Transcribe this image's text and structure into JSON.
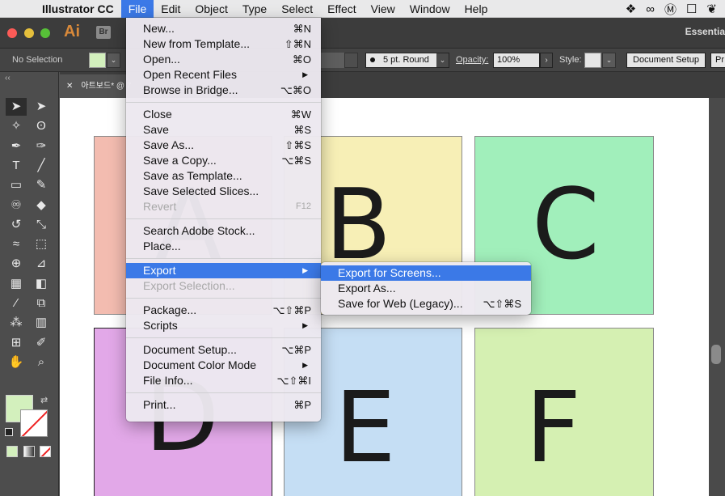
{
  "menubar": {
    "apple": "",
    "app_name": "Illustrator CC",
    "items": [
      "File",
      "Edit",
      "Object",
      "Type",
      "Select",
      "Effect",
      "View",
      "Window",
      "Help"
    ],
    "status_icons": [
      "dropbox-icon",
      "creative-cloud-icon",
      "malwarebytes-icon",
      "square-icon",
      "evernote-icon"
    ]
  },
  "appbar": {
    "ai_logo": "Ai",
    "br_logo": "Br",
    "workspace": "Essentia"
  },
  "controlbar": {
    "selection": "No Selection",
    "brush": "5 pt. Round",
    "opacity_label": "Opacity:",
    "opacity_value": "100%",
    "style_label": "Style:",
    "document_setup": "Document Setup",
    "preferences": "Pr",
    "fill_color": "#d3f0bd"
  },
  "document_tab": {
    "title": "아트보드* @ 7"
  },
  "artboards": [
    {
      "letter": "A",
      "color": "#f3bcb0"
    },
    {
      "letter": "B",
      "color": "#f7efb6"
    },
    {
      "letter": "C",
      "color": "#a1efbb"
    },
    {
      "letter": "D",
      "color": "#e2a8e8"
    },
    {
      "letter": "E",
      "color": "#c5def4"
    },
    {
      "letter": "F",
      "color": "#d5f0b2"
    }
  ],
  "file_menu": {
    "groups": [
      [
        {
          "label": "New...",
          "shortcut": "⌘N"
        },
        {
          "label": "New from Template...",
          "shortcut": "⇧⌘N"
        },
        {
          "label": "Open...",
          "shortcut": "⌘O"
        },
        {
          "label": "Open Recent Files",
          "submenu": true
        },
        {
          "label": "Browse in Bridge...",
          "shortcut": "⌥⌘O"
        }
      ],
      [
        {
          "label": "Close",
          "shortcut": "⌘W"
        },
        {
          "label": "Save",
          "shortcut": "⌘S"
        },
        {
          "label": "Save As...",
          "shortcut": "⇧⌘S"
        },
        {
          "label": "Save a Copy...",
          "shortcut": "⌥⌘S"
        },
        {
          "label": "Save as Template..."
        },
        {
          "label": "Save Selected Slices..."
        },
        {
          "label": "Revert",
          "shortcut": "F12",
          "disabled": true
        }
      ],
      [
        {
          "label": "Search Adobe Stock..."
        },
        {
          "label": "Place..."
        }
      ],
      [
        {
          "label": "Export",
          "submenu": true,
          "highlighted": true
        },
        {
          "label": "Export Selection...",
          "disabled": true
        }
      ],
      [
        {
          "label": "Package...",
          "shortcut": "⌥⇧⌘P"
        },
        {
          "label": "Scripts",
          "submenu": true
        }
      ],
      [
        {
          "label": "Document Setup...",
          "shortcut": "⌥⌘P"
        },
        {
          "label": "Document Color Mode",
          "submenu": true
        },
        {
          "label": "File Info...",
          "shortcut": "⌥⇧⌘I"
        }
      ],
      [
        {
          "label": "Print...",
          "shortcut": "⌘P"
        }
      ]
    ]
  },
  "export_submenu": [
    {
      "label": "Export for Screens...",
      "highlighted": true
    },
    {
      "label": "Export As..."
    },
    {
      "label": "Save for Web (Legacy)...",
      "shortcut": "⌥⇧⌘S"
    }
  ],
  "tools": [
    {
      "name": "selection-tool",
      "glyph": "➤",
      "selected": true
    },
    {
      "name": "direct-selection-tool",
      "glyph": "➤"
    },
    {
      "name": "magic-wand-tool",
      "glyph": "✧"
    },
    {
      "name": "lasso-tool",
      "glyph": "ʘ"
    },
    {
      "name": "pen-tool",
      "glyph": "✒"
    },
    {
      "name": "curvature-tool",
      "glyph": "✑"
    },
    {
      "name": "type-tool",
      "glyph": "T"
    },
    {
      "name": "line-segment-tool",
      "glyph": "╱"
    },
    {
      "name": "rectangle-tool",
      "glyph": "▭"
    },
    {
      "name": "paintbrush-tool",
      "glyph": "✎"
    },
    {
      "name": "shaper-tool",
      "glyph": "♾"
    },
    {
      "name": "eraser-tool",
      "glyph": "◆"
    },
    {
      "name": "rotate-tool",
      "glyph": "↺"
    },
    {
      "name": "scale-tool",
      "glyph": "⤡"
    },
    {
      "name": "width-tool",
      "glyph": "≈"
    },
    {
      "name": "free-transform-tool",
      "glyph": "⬚"
    },
    {
      "name": "shape-builder-tool",
      "glyph": "⊕"
    },
    {
      "name": "perspective-grid-tool",
      "glyph": "⊿"
    },
    {
      "name": "mesh-tool",
      "glyph": "▦"
    },
    {
      "name": "gradient-tool",
      "glyph": "◧"
    },
    {
      "name": "eyedropper-tool",
      "glyph": "⁄"
    },
    {
      "name": "blend-tool",
      "glyph": "⧉"
    },
    {
      "name": "symbol-sprayer-tool",
      "glyph": "⁂"
    },
    {
      "name": "column-graph-tool",
      "glyph": "▥"
    },
    {
      "name": "artboard-tool",
      "glyph": "⊞"
    },
    {
      "name": "slice-tool",
      "glyph": "✐"
    },
    {
      "name": "hand-tool",
      "glyph": "✋"
    },
    {
      "name": "zoom-tool",
      "glyph": "⌕"
    }
  ]
}
